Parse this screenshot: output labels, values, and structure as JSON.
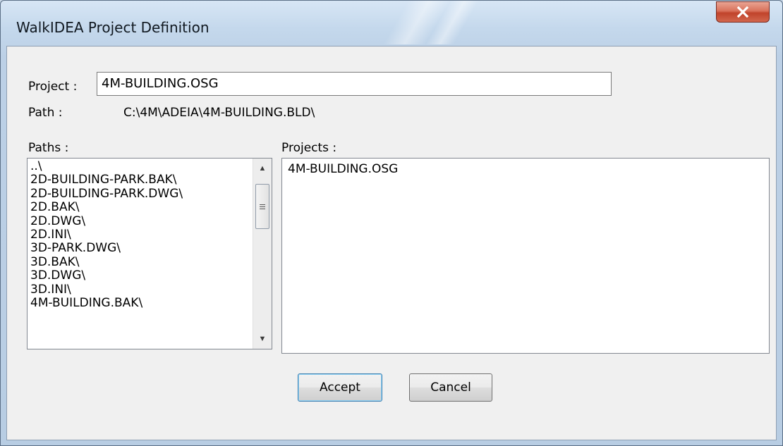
{
  "window": {
    "title": "WalkIDEA Project Definition",
    "close_icon": "close-x-icon"
  },
  "project": {
    "label": "Project :",
    "value": "4M-BUILDING.OSG"
  },
  "path": {
    "label": "Path :",
    "value": "C:\\4M\\ADEIA\\4M-BUILDING.BLD\\"
  },
  "paths_list": {
    "label": "Paths :",
    "items": [
      "..\\",
      "2D-BUILDING-PARK.BAK\\",
      "2D-BUILDING-PARK.DWG\\",
      "2D.BAK\\",
      "2D.DWG\\",
      "2D.INI\\",
      "3D-PARK.DWG\\",
      "3D.BAK\\",
      "3D.DWG\\",
      "3D.INI\\",
      "4M-BUILDING.BAK\\"
    ]
  },
  "projects_list": {
    "label": "Projects :",
    "items": [
      "4M-BUILDING.OSG"
    ]
  },
  "buttons": {
    "accept": "Accept",
    "cancel": "Cancel"
  }
}
